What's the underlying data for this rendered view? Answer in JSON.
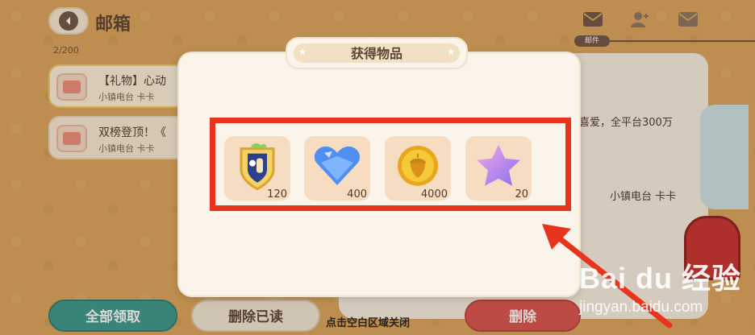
{
  "header": {
    "title": "邮箱",
    "mail_count": "2/200",
    "tab_badge": "邮件"
  },
  "mail_list": [
    {
      "title": "【礼物】心动",
      "sender": "小镇电台 卡卡"
    },
    {
      "title": "双榜登顶！《",
      "sender": "小镇电台 卡卡"
    }
  ],
  "detail": {
    "text": "喜爱，全平台300万",
    "sender": "小镇电台 卡卡"
  },
  "buttons": {
    "claim_all": "全部领取",
    "delete_read": "删除已读",
    "delete": "删除"
  },
  "close_hint": "点击空白区域关闭",
  "modal": {
    "title": "获得物品",
    "items": [
      {
        "icon": "badge-icon",
        "count": "120"
      },
      {
        "icon": "blue-heart-gem-icon",
        "count": "400"
      },
      {
        "icon": "gold-acorn-coin-icon",
        "count": "4000"
      },
      {
        "icon": "purple-star-icon",
        "count": "20"
      }
    ]
  },
  "watermark": {
    "logo": "Bai du 经验",
    "url": "jingyan.baidu.com"
  },
  "colors": {
    "background": "#d9a55c",
    "accent_green": "#3a9a8f",
    "accent_red": "#d9534f",
    "highlight_red": "#e8341c"
  }
}
